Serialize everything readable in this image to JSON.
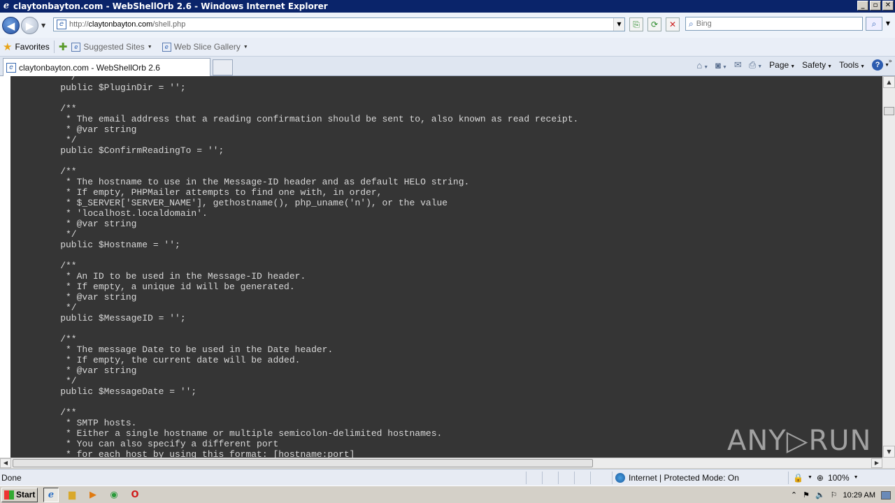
{
  "window": {
    "title": "claytonbayton.com - WebShellOrb 2.6 - Windows Internet Explorer",
    "controls": [
      "_",
      "▫",
      "✕"
    ]
  },
  "address_bar": {
    "url_prefix": "http://",
    "url_host": "claytonbayton.com",
    "url_path": "/shell.php",
    "search_placeholder": "Bing"
  },
  "favorites_bar": {
    "favorites_label": "Favorites",
    "items": [
      {
        "label": "Suggested Sites"
      },
      {
        "label": "Web Slice Gallery"
      }
    ]
  },
  "tabs": [
    {
      "label": "claytonbayton.com - WebShellOrb 2.6"
    }
  ],
  "command_bar": {
    "page_label": "Page",
    "safety_label": "Safety",
    "tools_label": "Tools"
  },
  "code_lines": [
    "     */",
    "    public $PluginDir = '';",
    "",
    "    /**",
    "     * The email address that a reading confirmation should be sent to, also known as read receipt.",
    "     * @var string",
    "     */",
    "    public $ConfirmReadingTo = '';",
    "",
    "    /**",
    "     * The hostname to use in the Message-ID header and as default HELO string.",
    "     * If empty, PHPMailer attempts to find one with, in order,",
    "     * $_SERVER['SERVER_NAME'], gethostname(), php_uname('n'), or the value",
    "     * 'localhost.localdomain'.",
    "     * @var string",
    "     */",
    "    public $Hostname = '';",
    "",
    "    /**",
    "     * An ID to be used in the Message-ID header.",
    "     * If empty, a unique id will be generated.",
    "     * @var string",
    "     */",
    "    public $MessageID = '';",
    "",
    "    /**",
    "     * The message Date to be used in the Date header.",
    "     * If empty, the current date will be added.",
    "     * @var string",
    "     */",
    "    public $MessageDate = '';",
    "",
    "    /**",
    "     * SMTP hosts.",
    "     * Either a single hostname or multiple semicolon-delimited hostnames.",
    "     * You can also specify a different port",
    "     * for each host by using this format: [hostname:port]"
  ],
  "watermark": "ANY▷RUN",
  "status_bar": {
    "status_text": "Done",
    "zone_text": "Internet | Protected Mode: On",
    "zoom_text": "100%"
  },
  "taskbar": {
    "start_label": "Start",
    "clock": "10:29 AM"
  }
}
